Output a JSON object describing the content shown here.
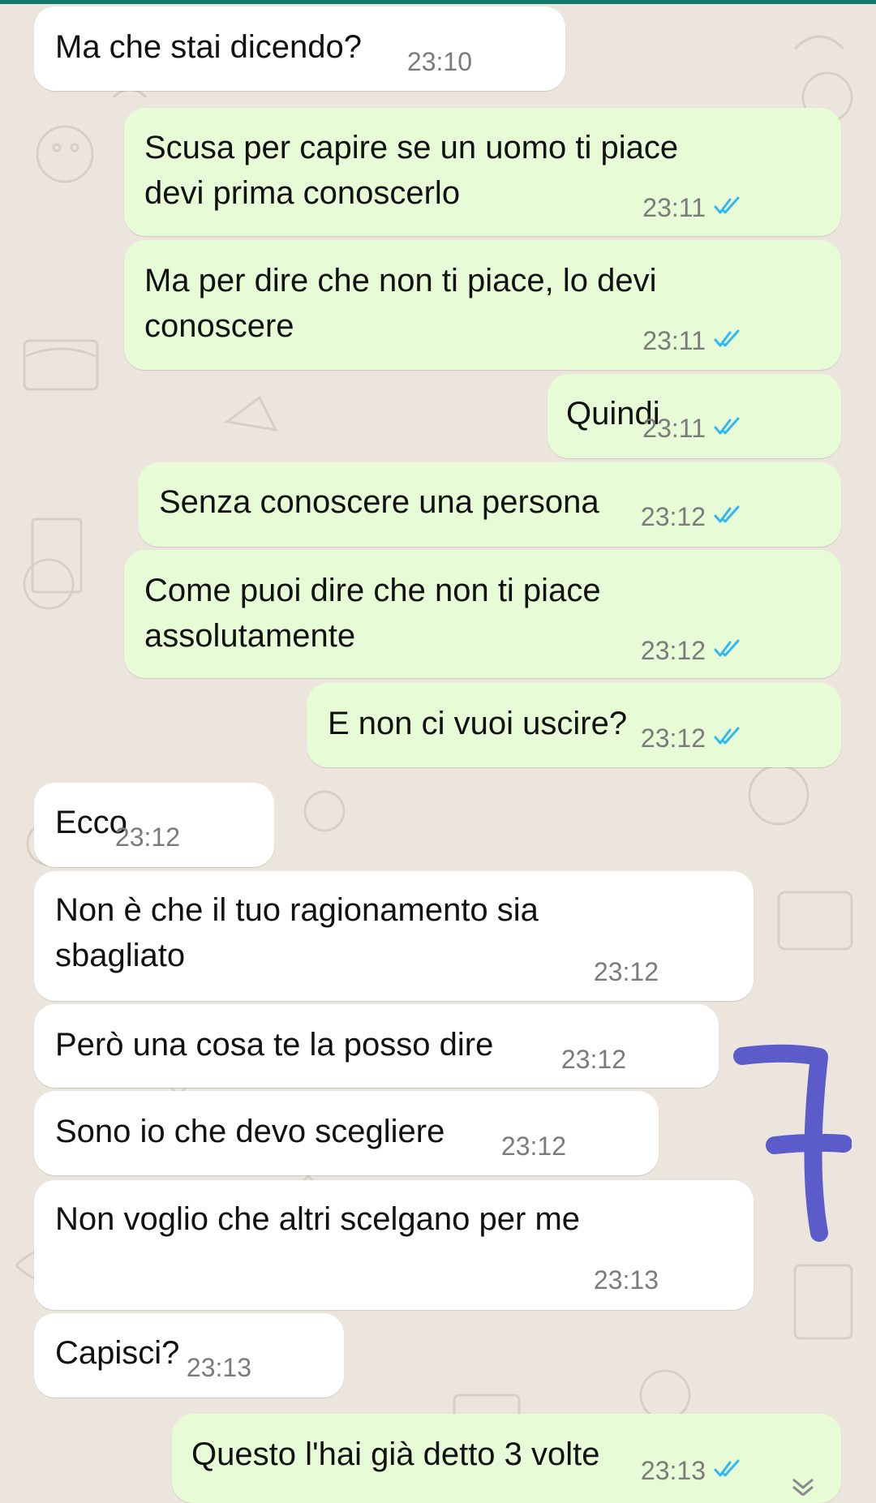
{
  "chat": {
    "messages": [
      {
        "dir": "in",
        "text": "Ma che stai dicendo?",
        "time": "23:10"
      },
      {
        "dir": "out",
        "text": "Scusa per capire se un uomo ti piace\ndevi prima conoscerlo",
        "time": "23:11",
        "status": "read"
      },
      {
        "dir": "out",
        "text": "Ma per dire che non ti piace, lo devi\nconoscere",
        "time": "23:11",
        "status": "read"
      },
      {
        "dir": "out",
        "text": "Quindi",
        "time": "23:11",
        "status": "read"
      },
      {
        "dir": "out",
        "text": "Senza conoscere una persona",
        "time": "23:12",
        "status": "read"
      },
      {
        "dir": "out",
        "text": "Come puoi dire che non ti piace\nassolutamente",
        "time": "23:12",
        "status": "read"
      },
      {
        "dir": "out",
        "text": "E non ci vuoi uscire?",
        "time": "23:12",
        "status": "read"
      },
      {
        "dir": "in",
        "text": "Ecco",
        "time": "23:12"
      },
      {
        "dir": "in",
        "text": "Non è che il tuo ragionamento sia\nsbagliato",
        "time": "23:12"
      },
      {
        "dir": "in",
        "text": "Però una cosa te la posso dire",
        "time": "23:12"
      },
      {
        "dir": "in",
        "text": "Sono io che devo scegliere",
        "time": "23:12"
      },
      {
        "dir": "in",
        "text": "Non voglio che altri scelgano per me",
        "time": "23:13"
      },
      {
        "dir": "in",
        "text": "Capisci?",
        "time": "23:13"
      },
      {
        "dir": "out",
        "text": "Questo l'hai già detto 3 volte",
        "time": "23:13",
        "status": "read"
      }
    ]
  },
  "annotation": {
    "text": "7",
    "color": "#5b5bc9"
  },
  "colors": {
    "incoming": "#ffffff",
    "outgoing": "#e7fbd6",
    "read_tick": "#34b7f1",
    "background": "#ece5dd"
  },
  "icons": {
    "read_receipt": "double-check-icon",
    "scroll_down": "chevron-double-down-icon"
  }
}
